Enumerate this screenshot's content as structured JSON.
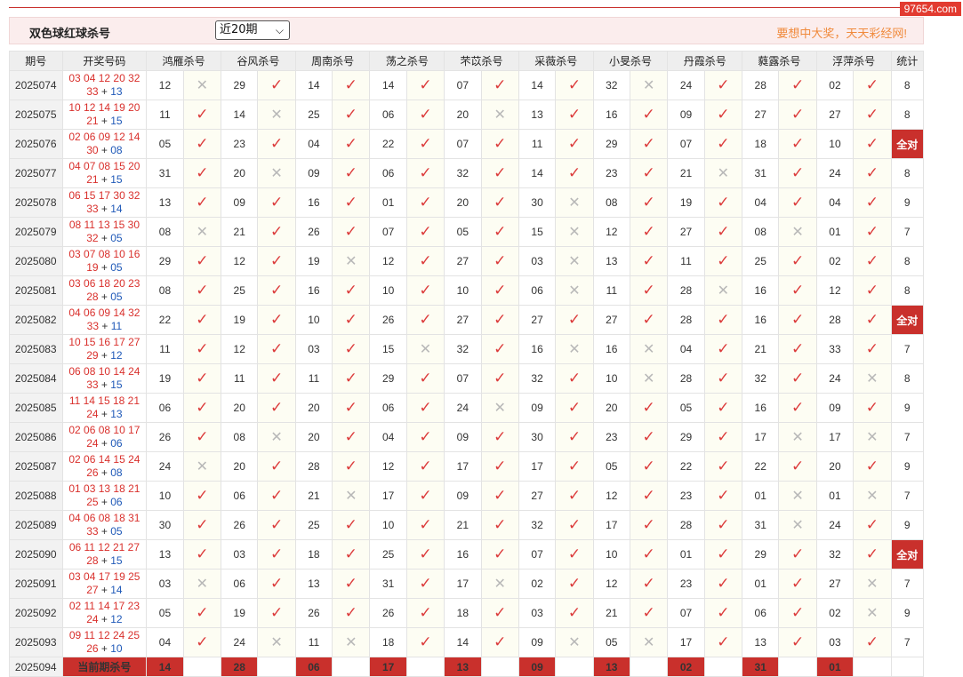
{
  "watermark": "97654.com",
  "header": {
    "title": "双色球红球杀号",
    "period_select": "近20期",
    "slogan": "要想中大奖，天天彩经网!"
  },
  "columns": {
    "period": "期号",
    "draw": "开奖号码",
    "experts": [
      "鸿雁杀号",
      "谷风杀号",
      "周南杀号",
      "荡之杀号",
      "芣苡杀号",
      "采薇杀号",
      "小旻杀号",
      "丹霞杀号",
      "蕤露杀号",
      "浮萍杀号"
    ],
    "total": "统计"
  },
  "symbols": {
    "ok": "✓",
    "no": "✕"
  },
  "rows": [
    {
      "period": "2025074",
      "reds_top": "03 04 12 20 32",
      "reds_bottom": "33",
      "blue": "13",
      "kills": [
        "12",
        "29",
        "14",
        "14",
        "07",
        "14",
        "32",
        "24",
        "28",
        "02"
      ],
      "results": [
        0,
        1,
        1,
        1,
        1,
        1,
        0,
        1,
        1,
        1
      ],
      "total": "8"
    },
    {
      "period": "2025075",
      "reds_top": "10 12 14 19 20",
      "reds_bottom": "21",
      "blue": "15",
      "kills": [
        "11",
        "14",
        "25",
        "06",
        "20",
        "13",
        "16",
        "09",
        "27",
        "27"
      ],
      "results": [
        1,
        0,
        1,
        1,
        0,
        1,
        1,
        1,
        1,
        1
      ],
      "total": "8"
    },
    {
      "period": "2025076",
      "reds_top": "02 06 09 12 14",
      "reds_bottom": "30",
      "blue": "08",
      "kills": [
        "05",
        "23",
        "04",
        "22",
        "07",
        "11",
        "29",
        "07",
        "18",
        "10"
      ],
      "results": [
        1,
        1,
        1,
        1,
        1,
        1,
        1,
        1,
        1,
        1
      ],
      "total": "全对"
    },
    {
      "period": "2025077",
      "reds_top": "04 07 08 15 20",
      "reds_bottom": "21",
      "blue": "15",
      "kills": [
        "31",
        "20",
        "09",
        "06",
        "32",
        "14",
        "23",
        "21",
        "31",
        "24"
      ],
      "results": [
        1,
        0,
        1,
        1,
        1,
        1,
        1,
        0,
        1,
        1
      ],
      "total": "8"
    },
    {
      "period": "2025078",
      "reds_top": "06 15 17 30 32",
      "reds_bottom": "33",
      "blue": "14",
      "kills": [
        "13",
        "09",
        "16",
        "01",
        "20",
        "30",
        "08",
        "19",
        "04",
        "04"
      ],
      "results": [
        1,
        1,
        1,
        1,
        1,
        0,
        1,
        1,
        1,
        1
      ],
      "total": "9"
    },
    {
      "period": "2025079",
      "reds_top": "08 11 13 15 30",
      "reds_bottom": "32",
      "blue": "05",
      "kills": [
        "08",
        "21",
        "26",
        "07",
        "05",
        "15",
        "12",
        "27",
        "08",
        "01"
      ],
      "results": [
        0,
        1,
        1,
        1,
        1,
        0,
        1,
        1,
        0,
        1
      ],
      "total": "7"
    },
    {
      "period": "2025080",
      "reds_top": "03 07 08 10 16",
      "reds_bottom": "19",
      "blue": "05",
      "kills": [
        "29",
        "12",
        "19",
        "12",
        "27",
        "03",
        "13",
        "11",
        "25",
        "02"
      ],
      "results": [
        1,
        1,
        0,
        1,
        1,
        0,
        1,
        1,
        1,
        1
      ],
      "total": "8"
    },
    {
      "period": "2025081",
      "reds_top": "03 06 18 20 23",
      "reds_bottom": "28",
      "blue": "05",
      "kills": [
        "08",
        "25",
        "16",
        "10",
        "10",
        "06",
        "11",
        "28",
        "16",
        "12"
      ],
      "results": [
        1,
        1,
        1,
        1,
        1,
        0,
        1,
        0,
        1,
        1
      ],
      "total": "8"
    },
    {
      "period": "2025082",
      "reds_top": "04 06 09 14 32",
      "reds_bottom": "33",
      "blue": "11",
      "kills": [
        "22",
        "19",
        "10",
        "26",
        "27",
        "27",
        "27",
        "28",
        "16",
        "28"
      ],
      "results": [
        1,
        1,
        1,
        1,
        1,
        1,
        1,
        1,
        1,
        1
      ],
      "total": "全对"
    },
    {
      "period": "2025083",
      "reds_top": "10 15 16 17 27",
      "reds_bottom": "29",
      "blue": "12",
      "kills": [
        "11",
        "12",
        "03",
        "15",
        "32",
        "16",
        "16",
        "04",
        "21",
        "33"
      ],
      "results": [
        1,
        1,
        1,
        0,
        1,
        0,
        0,
        1,
        1,
        1
      ],
      "total": "7"
    },
    {
      "period": "2025084",
      "reds_top": "06 08 10 14 24",
      "reds_bottom": "33",
      "blue": "15",
      "kills": [
        "19",
        "11",
        "11",
        "29",
        "07",
        "32",
        "10",
        "28",
        "32",
        "24"
      ],
      "results": [
        1,
        1,
        1,
        1,
        1,
        1,
        0,
        1,
        1,
        0
      ],
      "total": "8"
    },
    {
      "period": "2025085",
      "reds_top": "11 14 15 18 21",
      "reds_bottom": "24",
      "blue": "13",
      "kills": [
        "06",
        "20",
        "20",
        "06",
        "24",
        "09",
        "20",
        "05",
        "16",
        "09"
      ],
      "results": [
        1,
        1,
        1,
        1,
        0,
        1,
        1,
        1,
        1,
        1
      ],
      "total": "9"
    },
    {
      "period": "2025086",
      "reds_top": "02 06 08 10 17",
      "reds_bottom": "24",
      "blue": "06",
      "kills": [
        "26",
        "08",
        "20",
        "04",
        "09",
        "30",
        "23",
        "29",
        "17",
        "17"
      ],
      "results": [
        1,
        0,
        1,
        1,
        1,
        1,
        1,
        1,
        0,
        0
      ],
      "total": "7"
    },
    {
      "period": "2025087",
      "reds_top": "02 06 14 15 24",
      "reds_bottom": "26",
      "blue": "08",
      "kills": [
        "24",
        "20",
        "28",
        "12",
        "17",
        "17",
        "05",
        "22",
        "22",
        "20"
      ],
      "results": [
        0,
        1,
        1,
        1,
        1,
        1,
        1,
        1,
        1,
        1
      ],
      "total": "9"
    },
    {
      "period": "2025088",
      "reds_top": "01 03 13 18 21",
      "reds_bottom": "25",
      "blue": "06",
      "kills": [
        "10",
        "06",
        "21",
        "17",
        "09",
        "27",
        "12",
        "23",
        "01",
        "01"
      ],
      "results": [
        1,
        1,
        0,
        1,
        1,
        1,
        1,
        1,
        0,
        0
      ],
      "total": "7"
    },
    {
      "period": "2025089",
      "reds_top": "04 06 08 18 31",
      "reds_bottom": "33",
      "blue": "05",
      "kills": [
        "30",
        "26",
        "25",
        "10",
        "21",
        "32",
        "17",
        "28",
        "31",
        "24"
      ],
      "results": [
        1,
        1,
        1,
        1,
        1,
        1,
        1,
        1,
        0,
        1
      ],
      "total": "9"
    },
    {
      "period": "2025090",
      "reds_top": "06 11 12 21 27",
      "reds_bottom": "28",
      "blue": "15",
      "kills": [
        "13",
        "03",
        "18",
        "25",
        "16",
        "07",
        "10",
        "01",
        "29",
        "32"
      ],
      "results": [
        1,
        1,
        1,
        1,
        1,
        1,
        1,
        1,
        1,
        1
      ],
      "total": "全对"
    },
    {
      "period": "2025091",
      "reds_top": "03 04 17 19 25",
      "reds_bottom": "27",
      "blue": "14",
      "kills": [
        "03",
        "06",
        "13",
        "31",
        "17",
        "02",
        "12",
        "23",
        "01",
        "27"
      ],
      "results": [
        0,
        1,
        1,
        1,
        0,
        1,
        1,
        1,
        1,
        0
      ],
      "total": "7"
    },
    {
      "period": "2025092",
      "reds_top": "02 11 14 17 23",
      "reds_bottom": "24",
      "blue": "12",
      "kills": [
        "05",
        "19",
        "26",
        "26",
        "18",
        "03",
        "21",
        "07",
        "06",
        "02"
      ],
      "results": [
        1,
        1,
        1,
        1,
        1,
        1,
        1,
        1,
        1,
        0
      ],
      "total": "9"
    },
    {
      "period": "2025093",
      "reds_top": "09 11 12 24 25",
      "reds_bottom": "26",
      "blue": "10",
      "kills": [
        "04",
        "24",
        "11",
        "18",
        "14",
        "09",
        "05",
        "17",
        "13",
        "03"
      ],
      "results": [
        1,
        0,
        0,
        1,
        1,
        0,
        0,
        1,
        1,
        1
      ],
      "total": "7"
    }
  ],
  "current": {
    "period": "2025094",
    "label": "当前期杀号",
    "kills": [
      "14",
      "28",
      "06",
      "17",
      "13",
      "09",
      "13",
      "02",
      "31",
      "01"
    ]
  }
}
